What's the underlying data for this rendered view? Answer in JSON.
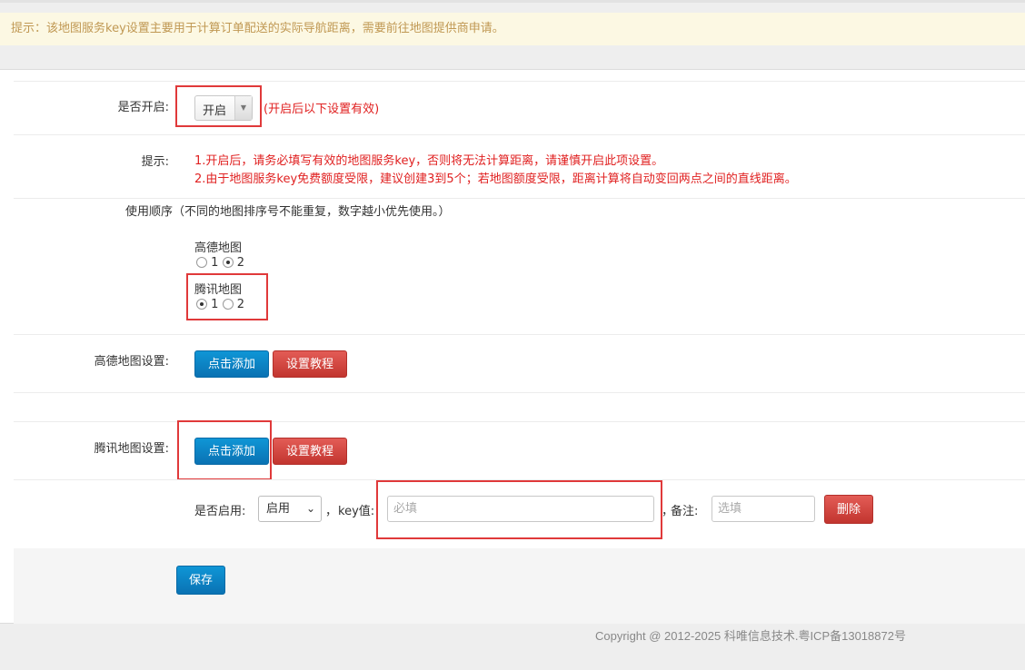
{
  "notice": {
    "text": "提示：该地图服务key设置主要用于计算订单配送的实际导航距离，需要前往地图提供商申请。"
  },
  "enable": {
    "label": "是否开启:",
    "value": "开启",
    "note": "(开启后以下设置有效)"
  },
  "tips": {
    "label": "提示:",
    "line1": "1.开启后，请务必填写有效的地图服务key，否则将无法计算距离，请谨慎开启此项设置。",
    "line2": "2.由于地图服务key免费额度受限，建议创建3到5个；若地图额度受限，距离计算将自动变回两点之间的直线距离。"
  },
  "order": {
    "label": "使用顺序（不同的地图排序号不能重复，数字越小优先使用。）",
    "maps": [
      {
        "name": "高德地图",
        "options": [
          "1",
          "2"
        ],
        "selected": "2"
      },
      {
        "name": "腾讯地图",
        "options": [
          "1",
          "2"
        ],
        "selected": "1"
      }
    ]
  },
  "amap": {
    "label": "高德地图设置:",
    "add_label": "点击添加",
    "tutorial_label": "设置教程"
  },
  "tencent": {
    "label": "腾讯地图设置:",
    "add_label": "点击添加",
    "tutorial_label": "设置教程",
    "row": {
      "enabled_label": "是否启用:",
      "enabled_value": "启用",
      "comma": "，",
      "key_label": "key值:",
      "key_placeholder": "必填",
      "note_comma": "，",
      "note_label": "备注:",
      "note_placeholder": "选填",
      "delete_label": "删除"
    }
  },
  "save_label": "保存",
  "footer": {
    "copyright": "Copyright @ 2012-2025 科唯信息技术.粤ICP备13018872号"
  },
  "colors": {
    "primary": "#0a7fc4",
    "danger": "#d9443e",
    "highlight": "#e0393a",
    "notice_bg": "#fcf8e3",
    "notice_text": "#c09853"
  }
}
